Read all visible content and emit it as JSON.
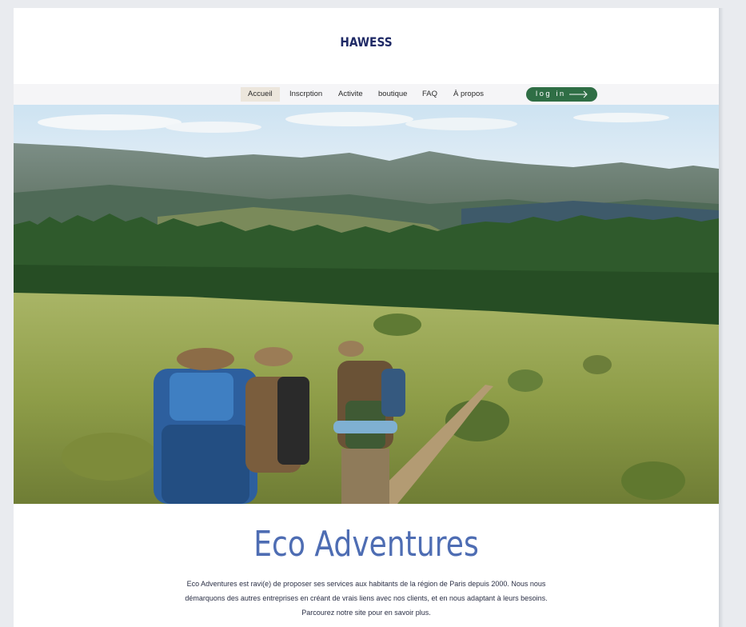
{
  "site": {
    "title": "HAWESS"
  },
  "nav": {
    "items": [
      {
        "label": "Accueil",
        "active": true
      },
      {
        "label": "Inscrption",
        "active": false
      },
      {
        "label": "Activite",
        "active": false
      },
      {
        "label": "boutique",
        "active": false
      },
      {
        "label": "FAQ",
        "active": false
      },
      {
        "label": "À propos",
        "active": false
      }
    ],
    "login_label": "log in",
    "login_icon": "arrow-right-icon"
  },
  "hero": {
    "description_icon": "hikers-in-mountain-meadow-photo"
  },
  "content": {
    "headline": "Eco Adventures",
    "description_lines": [
      "Eco Adventures est ravi(e) de proposer ses services aux habitants de la région de Paris depuis 2000. Nous nous",
      "démarquons des autres entreprises en créant de vrais liens avec nos clients, et en nous adaptant à leurs besoins.",
      "Parcourez notre site pour en savoir plus."
    ]
  },
  "colors": {
    "title": "#1f2a66",
    "headline": "#4e6db3",
    "login_button": "#2f6e45",
    "nav_bar": "#f5f5f7",
    "nav_active": "#ece6dc"
  }
}
